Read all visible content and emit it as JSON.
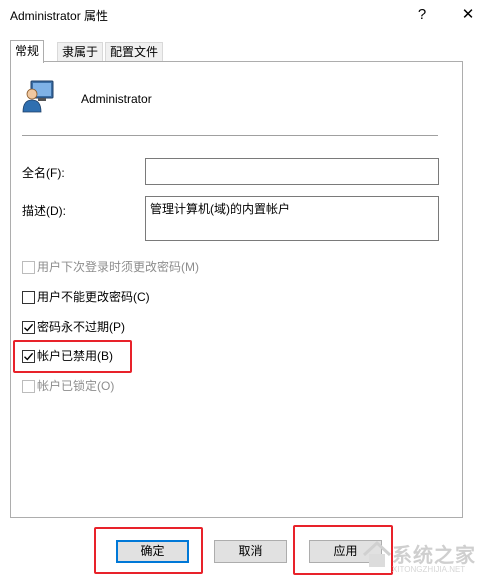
{
  "window": {
    "title": "Administrator 属性",
    "help_icon": "?",
    "close_icon": "✕"
  },
  "tabs": [
    {
      "label": "常规",
      "active": true
    },
    {
      "label": "隶属于",
      "active": false
    },
    {
      "label": "配置文件",
      "active": false
    }
  ],
  "user": {
    "icon": "user-monitor-icon",
    "name": "Administrator"
  },
  "form": {
    "fullname_label": "全名(F):",
    "fullname_value": "",
    "description_label": "描述(D):",
    "description_value": "管理计算机(域)的内置帐户"
  },
  "checkboxes": [
    {
      "label": "用户下次登录时须更改密码(M)",
      "checked": false,
      "enabled": false
    },
    {
      "label": "用户不能更改密码(C)",
      "checked": false,
      "enabled": true
    },
    {
      "label": "密码永不过期(P)",
      "checked": true,
      "enabled": true
    },
    {
      "label": "帐户已禁用(B)",
      "checked": true,
      "enabled": true
    },
    {
      "label": "帐户已锁定(O)",
      "checked": false,
      "enabled": false
    }
  ],
  "buttons": {
    "ok": "确定",
    "cancel": "取消",
    "apply": "应用"
  },
  "watermark": {
    "text": "系统之家",
    "url": "XITONGZHIJIA.NET"
  },
  "colors": {
    "highlight": "#e8222a",
    "focus": "#0078d7",
    "disabled_text": "#8d8d8d"
  }
}
